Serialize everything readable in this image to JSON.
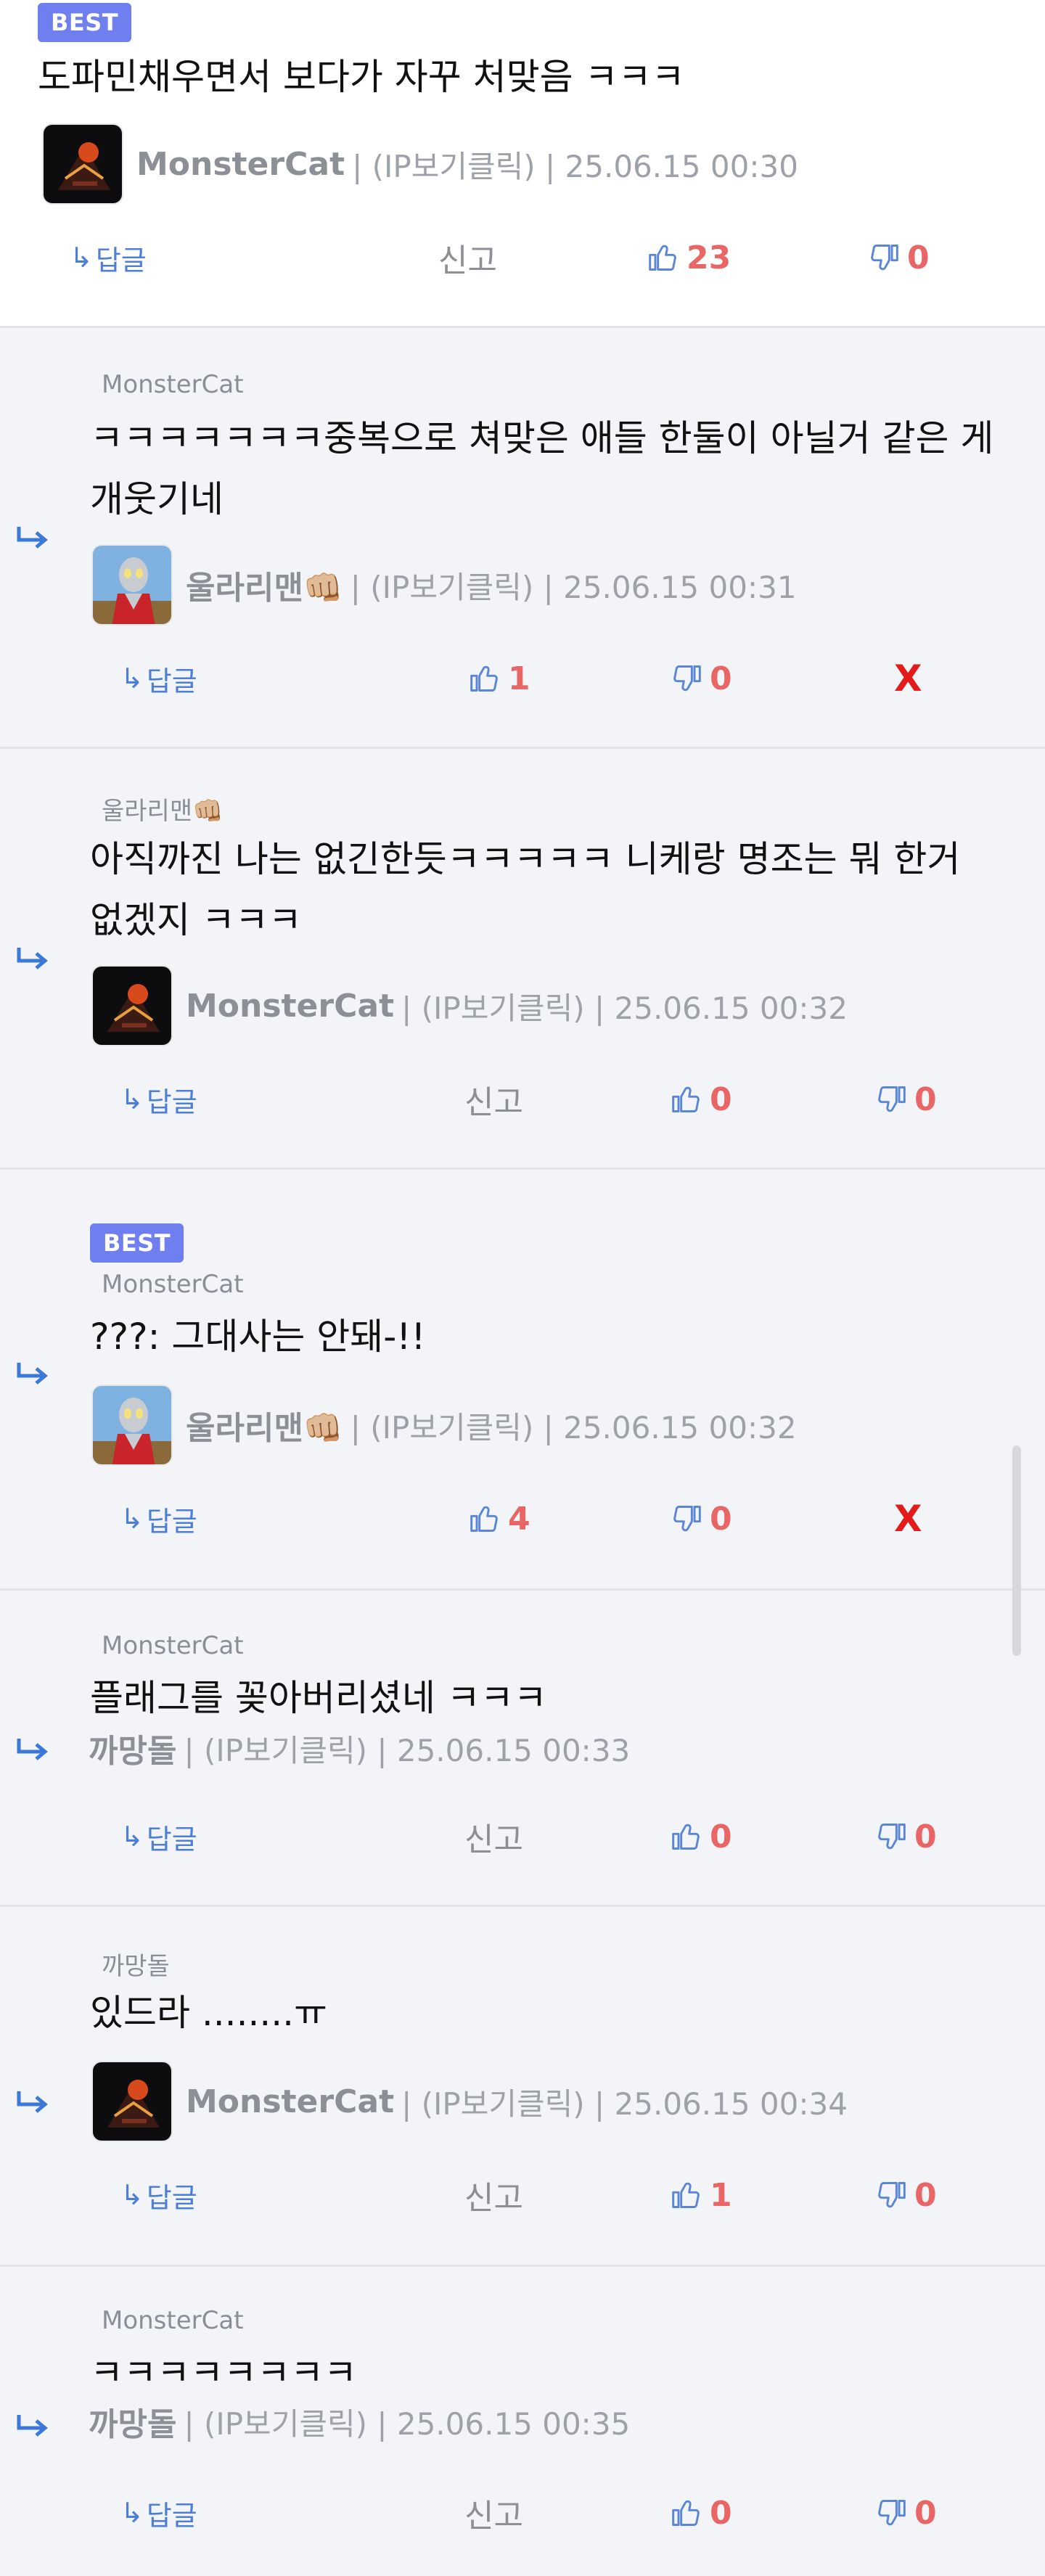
{
  "ui": {
    "best_label": "BEST",
    "reply_label": "답글",
    "report_label": "신고",
    "delete_label": "X",
    "ip_label": "(IP보기클릭)",
    "separator": "|"
  },
  "colors": {
    "badge": "#6f7ff0",
    "vote_count": "#e86666",
    "reply_link": "#4e7fd8",
    "delete": "#e31b1b",
    "reply_bg": "#f3f4f7"
  },
  "comments": [
    {
      "best": "BEST",
      "body": "도파민채우면서 보다가 자꾸 처맞음 ㅋㅋㅋ",
      "author": "MonsterCat",
      "meta": "| (IP보기클릭) | 25.06.15 00:30",
      "up": "23",
      "down": "0",
      "extra": "신고",
      "avatar_icon": "monstercat-avatar-icon"
    },
    {
      "parent": "MonsterCat",
      "body": "ㅋㅋㅋㅋㅋㅋㅋ중복으로 쳐맞은 애들 한둘이 아닐거 같은 게 개웃기네",
      "author": "울라리맨👊🏼",
      "meta": "| (IP보기클릭) | 25.06.15 00:31",
      "up": "1",
      "down": "0",
      "extra": "X",
      "avatar_icon": "ultraman-avatar-icon"
    },
    {
      "parent": "울라리맨👊🏼",
      "body": "아직까진 나는 없긴한듯ㅋㅋㅋㅋㅋ 니케랑 명조는 뭐 한거 없겠지 ㅋㅋㅋ",
      "author": "MonsterCat",
      "meta": "| (IP보기클릭) | 25.06.15 00:32",
      "up": "0",
      "down": "0",
      "extra": "신고",
      "avatar_icon": "monstercat-avatar-icon"
    },
    {
      "best": "BEST",
      "parent": "MonsterCat",
      "body": "???: 그대사는 안돼-!!",
      "author": "울라리맨👊🏼",
      "meta": "| (IP보기클릭) | 25.06.15 00:32",
      "up": "4",
      "down": "0",
      "extra": "X",
      "avatar_icon": "ultraman-avatar-icon"
    },
    {
      "parent": "MonsterCat",
      "body": "플래그를 꽂아버리셨네 ㅋㅋㅋ",
      "author": "까망돌",
      "meta": "| (IP보기클릭) | 25.06.15 00:33",
      "up": "0",
      "down": "0",
      "extra": "신고"
    },
    {
      "parent": "까망돌",
      "body": "있드라 ........ㅠ",
      "author": "MonsterCat",
      "meta": "| (IP보기클릭) | 25.06.15 00:34",
      "up": "1",
      "down": "0",
      "extra": "신고",
      "avatar_icon": "monstercat-avatar-icon"
    },
    {
      "parent": "MonsterCat",
      "body": "ㅋㅋㅋㅋㅋㅋㅋㅋ",
      "author": "까망돌",
      "meta": "| (IP보기클릭) | 25.06.15 00:35",
      "up": "0",
      "down": "0",
      "extra": "신고"
    }
  ]
}
